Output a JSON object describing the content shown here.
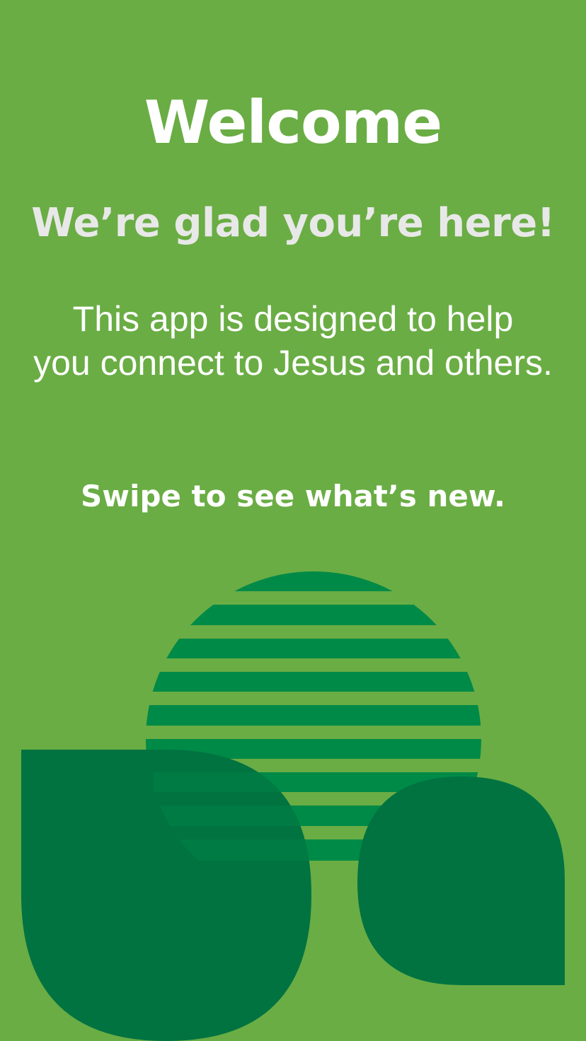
{
  "welcome": {
    "title": "Welcome",
    "subtitle": "We’re glad you’re here!",
    "body_line_1": "This app is designed to help",
    "body_line_2": "you connect to Jesus and others.",
    "cta": "Swipe to see what’s new."
  },
  "colors": {
    "background": "#6aad44",
    "stripe_green": "#008a47",
    "dark_green": "#007341"
  }
}
